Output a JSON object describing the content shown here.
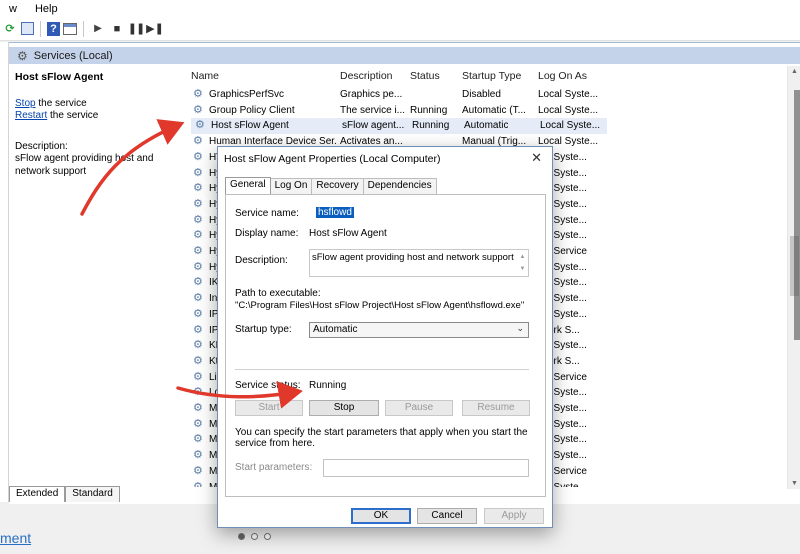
{
  "menu": {
    "items": [
      "w",
      "Help"
    ]
  },
  "panel": {
    "title": "Services (Local)"
  },
  "detail": {
    "title": "Host sFlow Agent",
    "stop_link": "Stop",
    "stop_rest": " the service",
    "restart_link": "Restart",
    "restart_rest": " the service",
    "description_label": "Description:",
    "description_text": "sFlow agent providing host and network support"
  },
  "list": {
    "columns": {
      "name": "Name",
      "description": "Description",
      "status": "Status",
      "startup": "Startup Type",
      "logon": "Log On As"
    },
    "rows": [
      {
        "name": "GraphicsPerfSvc",
        "description": "Graphics pe...",
        "status": "",
        "startup": "Disabled",
        "logon": "Local Syste..."
      },
      {
        "name": "Group Policy Client",
        "description": "The service i...",
        "status": "Running",
        "startup": "Automatic (T...",
        "logon": "Local Syste..."
      },
      {
        "name": "Host sFlow Agent",
        "description": "sFlow agent...",
        "status": "Running",
        "startup": "Automatic",
        "logon": "Local Syste..."
      },
      {
        "name": "Human Interface Device Ser...",
        "description": "Activates an...",
        "status": "",
        "startup": "Manual (Trig...",
        "logon": "Local Syste..."
      },
      {
        "name": "HV",
        "description": "",
        "status": "",
        "startup": "",
        "logon": "cal Syste..."
      },
      {
        "name": "Hy",
        "description": "",
        "status": "",
        "startup": "",
        "logon": "cal Syste..."
      },
      {
        "name": "Hy",
        "description": "",
        "status": "",
        "startup": "",
        "logon": "cal Syste..."
      },
      {
        "name": "Hy",
        "description": "",
        "status": "",
        "startup": "",
        "logon": "cal Syste..."
      },
      {
        "name": "Hy",
        "description": "",
        "status": "",
        "startup": "",
        "logon": "cal Syste..."
      },
      {
        "name": "Hy",
        "description": "",
        "status": "",
        "startup": "",
        "logon": "cal Syste..."
      },
      {
        "name": "Hy",
        "description": "",
        "status": "",
        "startup": "",
        "logon": "cal Service"
      },
      {
        "name": "Hy",
        "description": "",
        "status": "",
        "startup": "",
        "logon": "cal Syste..."
      },
      {
        "name": "IKE",
        "description": "",
        "status": "",
        "startup": "",
        "logon": "cal Syste..."
      },
      {
        "name": "Int",
        "description": "",
        "status": "",
        "startup": "",
        "logon": "cal Syste..."
      },
      {
        "name": "IP",
        "description": "",
        "status": "",
        "startup": "",
        "logon": "cal Syste..."
      },
      {
        "name": "IPs",
        "description": "",
        "status": "",
        "startup": "",
        "logon": "twork S..."
      },
      {
        "name": "KD",
        "description": "",
        "status": "",
        "startup": "",
        "logon": "cal Syste..."
      },
      {
        "name": "Ktr",
        "description": "",
        "status": "",
        "startup": "",
        "logon": "twork S..."
      },
      {
        "name": "Lin",
        "description": "",
        "status": "",
        "startup": "",
        "logon": "cal Service"
      },
      {
        "name": "Lo",
        "description": "",
        "status": "",
        "startup": "",
        "logon": "cal Syste..."
      },
      {
        "name": "Mi",
        "description": "",
        "status": "",
        "startup": "",
        "logon": "cal Syste..."
      },
      {
        "name": "Mi",
        "description": "",
        "status": "",
        "startup": "",
        "logon": "cal Syste..."
      },
      {
        "name": "Mi",
        "description": "",
        "status": "",
        "startup": "",
        "logon": "cal Syste..."
      },
      {
        "name": "Mi",
        "description": "",
        "status": "",
        "startup": "",
        "logon": "cal Syste..."
      },
      {
        "name": "Mi",
        "description": "",
        "status": "",
        "startup": "",
        "logon": "cal Service"
      },
      {
        "name": "Mi",
        "description": "",
        "status": "",
        "startup": "",
        "logon": "cal Syste..."
      }
    ]
  },
  "bottom_tabs": [
    "Extended",
    "Standard"
  ],
  "status_link": "ment",
  "dialog": {
    "title": "Host sFlow Agent Properties (Local Computer)",
    "close": "✕",
    "tabs": [
      "General",
      "Log On",
      "Recovery",
      "Dependencies"
    ],
    "service_name_label": "Service name:",
    "service_name_value": "hsflowd",
    "display_name_label": "Display name:",
    "display_name_value": "Host sFlow Agent",
    "description_label": "Description:",
    "description_value": "sFlow agent providing host and network support",
    "path_label": "Path to executable:",
    "path_value": "\"C:\\Program Files\\Host sFlow Project\\Host sFlow Agent\\hsflowd.exe\"",
    "startup_label": "Startup type:",
    "startup_value": "Automatic",
    "status_label": "Service status:",
    "status_value": "Running",
    "buttons": {
      "start": "Start",
      "stop": "Stop",
      "pause": "Pause",
      "resume": "Resume"
    },
    "hint": "You can specify the start parameters that apply when you start the service from here.",
    "params_label": "Start parameters:",
    "ok": "OK",
    "cancel": "Cancel",
    "apply": "Apply"
  },
  "colors": {
    "accent": "#0a5ebe",
    "arrow": "#e0392b",
    "header": "#c5d3ea"
  }
}
